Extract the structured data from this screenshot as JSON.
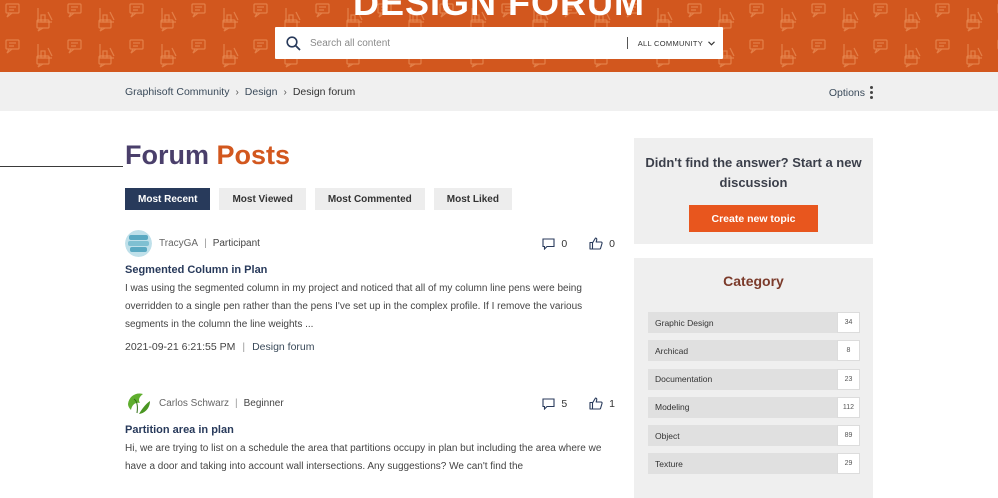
{
  "banner": {
    "title": "DESIGN FORUM",
    "color": "#d2571e"
  },
  "search": {
    "placeholder": "Search all content",
    "scope": "ALL COMMUNITY"
  },
  "breadcrumb": {
    "items": [
      "Graphisoft Community",
      "Design"
    ],
    "current": "Design forum"
  },
  "options_label": "Options",
  "page_title": {
    "part1": "Forum",
    "part2": "Posts"
  },
  "tabs": [
    {
      "label": "Most Recent",
      "active": true
    },
    {
      "label": "Most Viewed",
      "active": false
    },
    {
      "label": "Most Commented",
      "active": false
    },
    {
      "label": "Most Liked",
      "active": false
    }
  ],
  "posts": [
    {
      "author": "TracyGA",
      "rank": "Participant",
      "comments": "0",
      "likes": "0",
      "title": "Segmented Column in Plan",
      "body": "I was using the segmented column in my project and noticed that all of my column line pens were being overridden to a single pen rather than the pens I've set up in the complex profile. If I remove the various segments in the column the line weights ...",
      "date": "2021-09-21 6:21:55 PM",
      "board": "Design forum"
    },
    {
      "author": "Carlos Schwarz",
      "rank": "Beginner",
      "comments": "5",
      "likes": "1",
      "title": "Partition area in plan",
      "body": "Hi, we are trying to list on a schedule the area that partitions occupy in plan but including the area where we have a door and taking into account wall intersections. Any suggestions? We can't find the"
    }
  ],
  "cta": {
    "text": "Didn't find the answer? Start a new discussion",
    "button": "Create new topic"
  },
  "category": {
    "title": "Category",
    "items": [
      {
        "name": "Graphic Design",
        "count": "34"
      },
      {
        "name": "Archicad",
        "count": "8"
      },
      {
        "name": "Documentation",
        "count": "23"
      },
      {
        "name": "Modeling",
        "count": "112"
      },
      {
        "name": "Object",
        "count": "89"
      },
      {
        "name": "Texture",
        "count": "29"
      }
    ]
  }
}
